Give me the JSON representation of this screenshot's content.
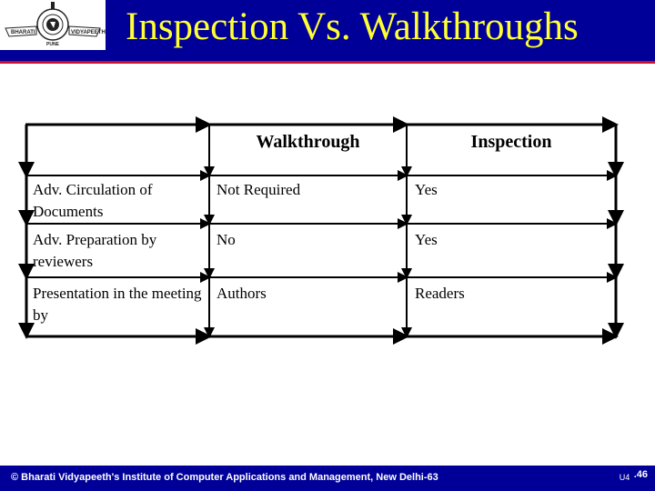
{
  "header": {
    "title": "Inspection Vs. Walkthroughs",
    "logo": {
      "left_text": "BHARATI",
      "right_text": "VIDYAPEETH",
      "bottom_text": "PUNE"
    },
    "colors": {
      "band": "#000099",
      "title": "#ffff33",
      "stripe": "#c8102e"
    }
  },
  "table": {
    "columns": [
      "",
      "Walkthrough",
      "Inspection"
    ],
    "rows": [
      {
        "label": "Adv. Circulation of Documents",
        "walkthrough": "Not Required",
        "inspection": "Yes"
      },
      {
        "label": "Adv. Preparation by reviewers",
        "walkthrough": "No",
        "inspection": "Yes"
      },
      {
        "label": "Presentation in the meeting by",
        "walkthrough": "Authors",
        "inspection": "Readers"
      }
    ]
  },
  "footer": {
    "text": "© Bharati Vidyapeeth's Institute of Computer Applications and Management, New Delhi-63",
    "unit": "U4",
    "slide_number": ".46"
  }
}
